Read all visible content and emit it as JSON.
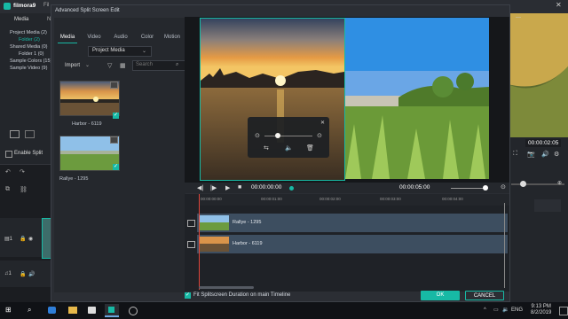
{
  "app": {
    "title": "filmora9",
    "menu_peek": "Fil"
  },
  "background_left": {
    "tab_media": "Media",
    "tab_peek": "N",
    "items": [
      "Project Media (2)",
      "Folder (2)",
      "Shared Media (0)",
      "Folder 1 (0)",
      "Sample Colors (15)",
      "Sample Video (9)"
    ],
    "enable_split_label": "Enable Split"
  },
  "background_right": {
    "timecode": "00:00:02:05"
  },
  "dialog": {
    "title": "Advanced Split Screen Edit",
    "tabs": [
      "Media",
      "Video",
      "Audio",
      "Color",
      "Motion"
    ],
    "project_select": "Project Media",
    "import_label": "Import",
    "search_placeholder": "Search",
    "media_items": [
      {
        "label": "Harbor - 6119"
      },
      {
        "label": "Rallye - 1295"
      }
    ],
    "player": {
      "current_time": "00:00:00:00",
      "total_time": "00:00:05:00"
    },
    "ruler_labels": [
      "00:00:00:00",
      "00:00:01:00",
      "00:00:02:00",
      "00:00:03:00",
      "00:00:04:00"
    ],
    "tracks": [
      {
        "label": "Rallye - 1295"
      },
      {
        "label": "Harbor - 6119"
      }
    ],
    "fit_label": "Fit Splitscreen Duration on main Timeline",
    "ok_label": "OK",
    "cancel_label": "CANCEL"
  },
  "taskbar": {
    "lang": "ENG",
    "time": "9:13 PM",
    "date": "8/2/2019"
  },
  "colors": {
    "accent": "#17b9a5",
    "dialog_bg": "#2b2e34",
    "track": "#3d4e60",
    "playhead": "#e0453a"
  }
}
